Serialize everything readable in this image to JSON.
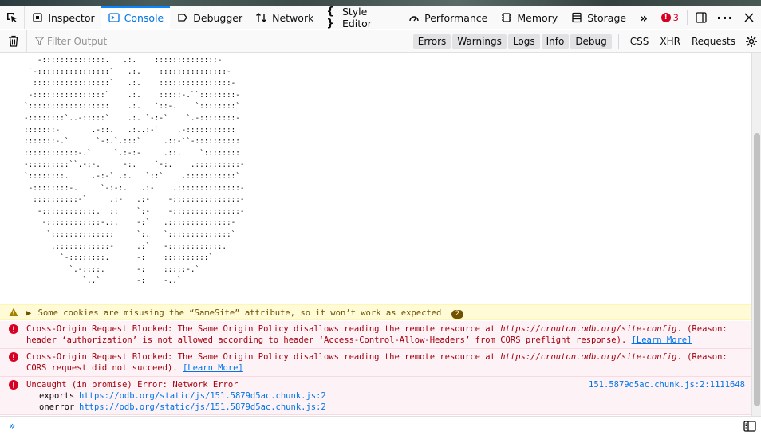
{
  "toolbar": {
    "tabs": [
      {
        "label": "Inspector",
        "icon": "inspector-icon"
      },
      {
        "label": "Console",
        "icon": "console-icon"
      },
      {
        "label": "Debugger",
        "icon": "debugger-icon"
      },
      {
        "label": "Network",
        "icon": "network-icon"
      },
      {
        "label": "Style Editor",
        "icon": "style-editor-icon"
      },
      {
        "label": "Performance",
        "icon": "performance-icon"
      },
      {
        "label": "Memory",
        "icon": "memory-icon"
      },
      {
        "label": "Storage",
        "icon": "storage-icon"
      }
    ],
    "selected_tab": "Console",
    "error_count": "3"
  },
  "filterbar": {
    "placeholder": "Filter Output",
    "levels": [
      {
        "label": "Errors",
        "on": true
      },
      {
        "label": "Warnings",
        "on": true
      },
      {
        "label": "Logs",
        "on": true
      },
      {
        "label": "Info",
        "on": true
      },
      {
        "label": "Debug",
        "on": true
      }
    ],
    "extras": [
      "CSS",
      "XHR",
      "Requests"
    ]
  },
  "ascii_art": "   -::::::::::::::.   .:.    ::::::::::::::-\n `-::::::::::::::::`   .:.    :::::::::::::::-\n  :::::::::::::::::`   .:.    ::::::::::::::::-\n -::::::::::::::::`    .:.    :::::-.``::::::::-\n`::::::::::::::::::    .:.   `::-.    `::::::::`\n-::::::::`..-:::::`    .:. `-:-`    `.-::::::::-\n:::::::-       .-::.   .:..:-`    .-:::::::::::\n:::::::-.`      `-:.`.:::`     .::-``-::::::::::\n::::::::::::-.`     `.:-:-     .::.    `::::::::\n-:::::::::``.-:-.     -:.    `-:.    .::::::::::-\n`::::::::.     .-:-` .:.   `::`    .:::::::::::`\n -::::::::-.     `-:-:.   .:-    .::::::::::::::-\n  ::::::::::-`     .:-   .:-    -:::::::::::::::-\n   -::::::::::::.  ::    `:-    -:::::::::::::::-\n    -::::::::::::-.:.    -:`   .::::::::::::::-\n     `::::::::::::::     `:.   `::::::::::::::`\n      .::::::::::::-     .:`   -::::::::::::.\n        `-::::::::.      -:    ::::::::::`\n          `.-::::.       -:    :::::-.`\n             `..`        -:    -..`",
  "messages": {
    "warning": {
      "text": "Some cookies are misusing the “SameSite” attribute, so it won’t work as expected",
      "count": "2"
    },
    "error1": {
      "prefix": "Cross-Origin Request Blocked: The Same Origin Policy disallows reading the remote resource at ",
      "url": "https://crouton.odb.org/site-config",
      "middle": ". (Reason: header ‘authorization’ is not allowed according to header ‘Access-Control-Allow-Headers’ from CORS preflight response). ",
      "link": "[Learn More]"
    },
    "error2": {
      "prefix": "Cross-Origin Request Blocked: The Same Origin Policy disallows reading the remote resource at ",
      "url": "https://crouton.odb.org/site-config",
      "middle": ". (Reason: CORS request did not succeed). ",
      "link": "[Learn More]"
    },
    "error3": {
      "text": "Uncaught (in promise) Error: Network Error",
      "location": "151.5879d5ac.chunk.js:2:1111648",
      "stack": [
        {
          "fn": "exports",
          "url": "https://odb.org/static/js/151.5879d5ac.chunk.js:2"
        },
        {
          "fn": "onerror",
          "url": "https://odb.org/static/js/151.5879d5ac.chunk.js:2"
        }
      ]
    }
  },
  "colors": {
    "accent": "#0a84ff",
    "error": "#d70022",
    "warning_bg": "#fffbd6",
    "error_bg": "#fdf2f5"
  }
}
